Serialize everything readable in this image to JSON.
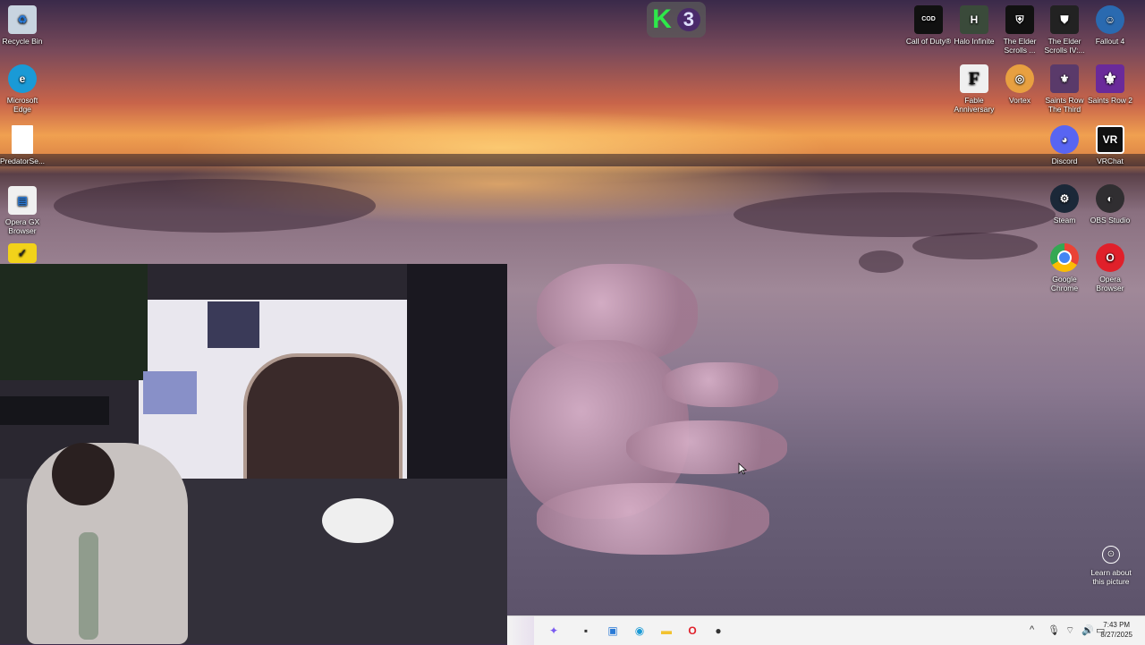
{
  "desktop": {
    "left_icons": [
      {
        "id": "recycle-bin",
        "label": "Recycle Bin",
        "icon": "recycle-bin-icon",
        "color": "#c8d4e0"
      },
      {
        "id": "edge",
        "label": "Microsoft Edge",
        "icon": "edge-icon",
        "color": "#1a9ad6"
      },
      {
        "id": "predator",
        "label": "PredatorSe...",
        "icon": "document-icon",
        "color": "#ffffff"
      },
      {
        "id": "opera-gx",
        "label": "Opera GX Browser",
        "icon": "opera-gx-icon",
        "color": "#f0f0f0"
      },
      {
        "id": "norton",
        "label": "",
        "icon": "checkmark-app-icon",
        "color": "#f2d21a"
      }
    ],
    "right_icons": [
      {
        "id": "cod",
        "label": "Call of Duty®",
        "icon": "call-of-duty-icon",
        "color": "#111111"
      },
      {
        "id": "halo",
        "label": "Halo Infinite",
        "icon": "halo-icon",
        "color": "#3a4a3a"
      },
      {
        "id": "skyrim",
        "label": "The Elder Scrolls ...",
        "icon": "elder-scrolls-icon",
        "color": "#111111"
      },
      {
        "id": "oblivion",
        "label": "The Elder Scrolls IV:...",
        "icon": "elder-scrolls-iv-icon",
        "color": "#222222"
      },
      {
        "id": "fallout4",
        "label": "Fallout 4",
        "icon": "fallout-icon",
        "color": "#2a6ab0"
      },
      {
        "id": "fable",
        "label": "Fable Anniversary",
        "icon": "fable-icon",
        "color": "#f0f0f0"
      },
      {
        "id": "vortex",
        "label": "Vortex",
        "icon": "vortex-icon",
        "color": "#e8a040"
      },
      {
        "id": "saints-third",
        "label": "Saints Row The Third",
        "icon": "saints-row-icon",
        "color": "#5a3a6a"
      },
      {
        "id": "saints2",
        "label": "Saints Row 2",
        "icon": "saints-row-2-icon",
        "color": "#6a2a9a"
      },
      {
        "id": "discord",
        "label": "Discord",
        "icon": "discord-icon",
        "color": "#5865f2"
      },
      {
        "id": "vrchat",
        "label": "VRChat",
        "icon": "vrchat-icon",
        "color": "#111111"
      },
      {
        "id": "steam",
        "label": "Steam",
        "icon": "steam-icon",
        "color": "#1b2838"
      },
      {
        "id": "obs",
        "label": "OBS Studio",
        "icon": "obs-icon",
        "color": "#302e31"
      },
      {
        "id": "chrome",
        "label": "Google Chrome",
        "icon": "chrome-icon",
        "color": "#4285f4"
      },
      {
        "id": "opera",
        "label": "Opera Browser",
        "icon": "opera-icon",
        "color": "#e0202a"
      }
    ]
  },
  "overlay_badge": {
    "k": "K",
    "n": "3"
  },
  "learn": {
    "label": "Learn about this picture",
    "icon": "camera-info-icon"
  },
  "taskbar": {
    "apps": [
      {
        "id": "copilot",
        "icon": "copilot-icon",
        "glyph": "✦",
        "color": "#7a5af0"
      },
      {
        "id": "task-view",
        "icon": "task-view-icon",
        "glyph": "▪",
        "color": "#333333"
      },
      {
        "id": "store",
        "icon": "store-icon",
        "glyph": "▣",
        "color": "#2a7ad6"
      },
      {
        "id": "edge",
        "icon": "edge-icon",
        "glyph": "◉",
        "color": "#1a9ad6"
      },
      {
        "id": "explorer",
        "icon": "folder-icon",
        "glyph": "▬",
        "color": "#f2c230"
      },
      {
        "id": "opera",
        "icon": "opera-icon",
        "glyph": "O",
        "color": "#e0202a"
      },
      {
        "id": "app",
        "icon": "app-icon",
        "glyph": "●",
        "color": "#333333"
      }
    ],
    "tray": {
      "chevron": "^",
      "time": "7:43 PM",
      "date": "8/27/2025"
    }
  }
}
